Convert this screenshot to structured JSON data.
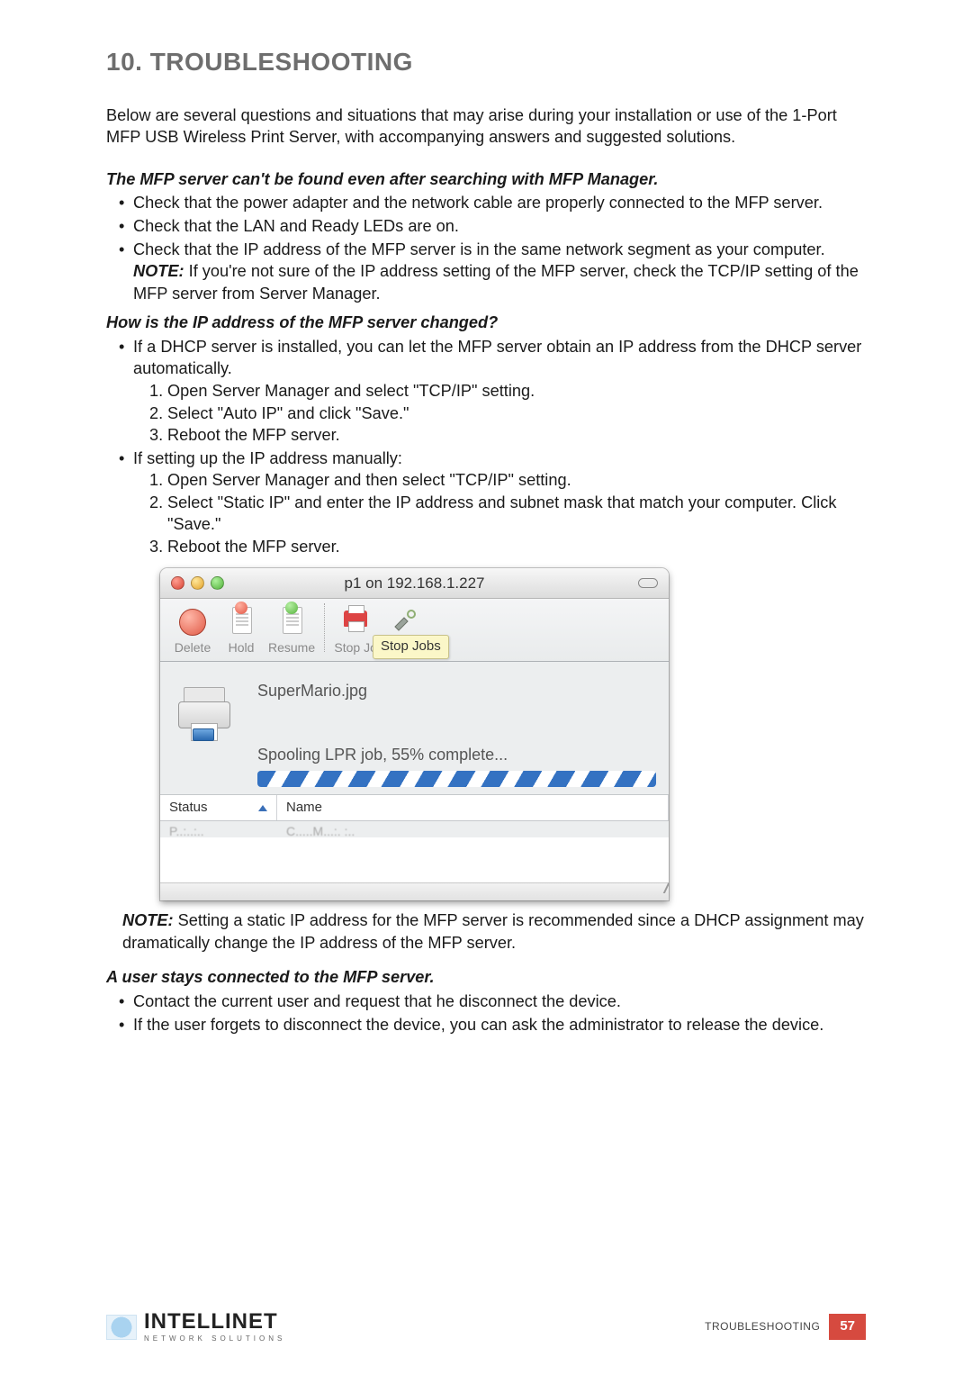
{
  "heading": "10. TROUBLESHOOTING",
  "intro": "Below are several questions and situations that may arise during your installation or use of the 1-Port MFP USB Wireless Print Server, with accompanying answers and suggested solutions.",
  "q1": {
    "title": "The MFP server can't be found even after searching with MFP Manager.",
    "bullets": [
      "Check that the power adapter and the network cable are properly connected to the MFP server.",
      "Check that the LAN and Ready LEDs are on."
    ],
    "bullet3_pre": "Check that the IP address of the MFP server is in the same network segment as your computer. ",
    "bullet3_note_word": "NOTE:",
    "bullet3_post": " If you're not sure of the IP address setting of the MFP server, check the TCP/IP setting of the MFP server from Server Manager."
  },
  "q2": {
    "title": "How is the IP address of the MFP server changed?",
    "bullet1": "If a DHCP server is installed, you can let the MFP server obtain an IP address from the DHCP server automatically.",
    "steps1": [
      "Open Server Manager and select \"TCP/IP\" setting.",
      "Select \"Auto IP\" and click \"Save.\"",
      "Reboot the MFP server."
    ],
    "bullet2": "If setting up the IP address manually:",
    "steps2": [
      "Open Server Manager and then select \"TCP/IP\" setting.",
      "Select \"Static IP\" and enter the IP address and subnet mask that match your computer. Click \"Save.\"",
      "Reboot the MFP server."
    ]
  },
  "screenshot": {
    "window_title": "p1  on 192.168.1.227",
    "toolbar": {
      "delete": "Delete",
      "hold": "Hold",
      "resume": "Resume",
      "stop_label": "Stop Jo",
      "tooltip": "Stop Jobs"
    },
    "job": {
      "filename": "SuperMario.jpg",
      "status_line": "Spooling LPR job, 55% complete..."
    },
    "table": {
      "col_status": "Status",
      "col_name": "Name",
      "row_status": "Printing",
      "row_name": "SuperMario.jpg"
    }
  },
  "note_after": {
    "word": "NOTE:",
    "text": " Setting a static IP address for the MFP server is recommended since a DHCP assignment may dramatically change the IP address of the MFP server."
  },
  "q3": {
    "title": "A user stays connected to the MFP server.",
    "bullets": [
      "Contact the current user and request that he disconnect the device.",
      "If the user forgets to disconnect the device, you can ask the administrator to release the device."
    ]
  },
  "footer": {
    "brand": "INTELLINET",
    "sub": "NETWORK SOLUTIONS",
    "section": "TROUBLESHOOTING",
    "page": "57"
  }
}
